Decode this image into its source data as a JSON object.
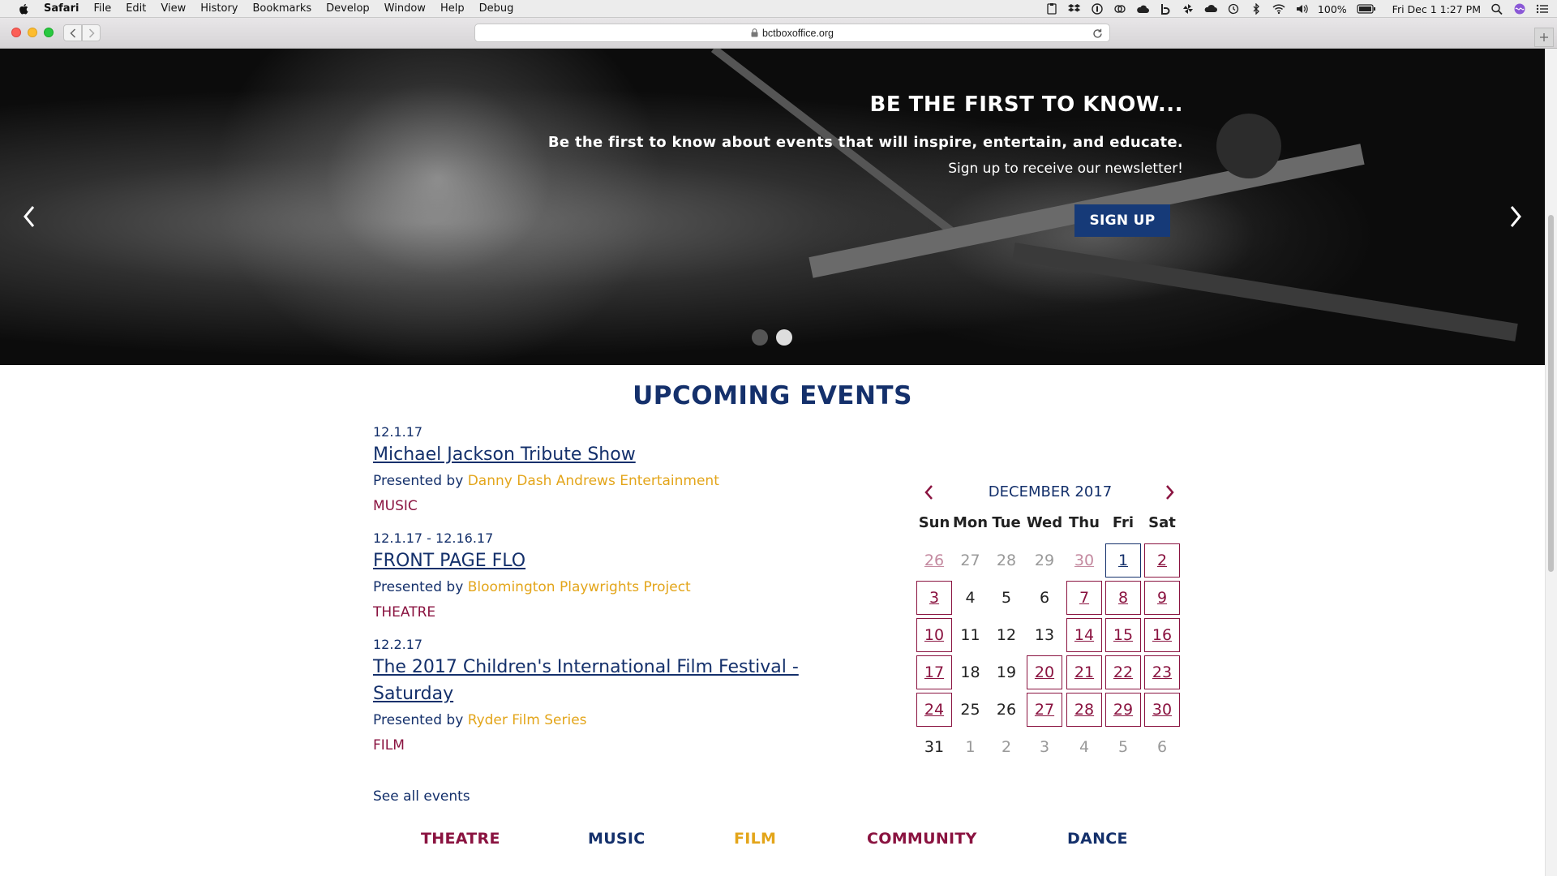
{
  "menubar": {
    "app": "Safari",
    "items": [
      "File",
      "Edit",
      "View",
      "History",
      "Bookmarks",
      "Develop",
      "Window",
      "Help",
      "Debug"
    ],
    "battery": "100%",
    "clock": "Fri Dec 1  1:27 PM"
  },
  "browser": {
    "url": "bctboxoffice.org"
  },
  "hero": {
    "title": "BE THE FIRST TO KNOW...",
    "line1": "Be the first to know about events that will inspire, entertain, and educate.",
    "line2": "Sign up to receive our newsletter!",
    "button": "SIGN UP",
    "slide_count": 2,
    "active_slide": 2
  },
  "events_section": {
    "heading": "UPCOMING EVENTS",
    "presented_by": "Presented by",
    "events": [
      {
        "date": "12.1.17",
        "title": "Michael Jackson Tribute Show",
        "presenter": "Danny Dash Andrews Entertainment",
        "category": "MUSIC"
      },
      {
        "date": "12.1.17 - 12.16.17",
        "title": "FRONT PAGE FLO",
        "presenter": "Bloomington Playwrights Project",
        "category": "THEATRE"
      },
      {
        "date": "12.2.17",
        "title": "The 2017 Children's International Film Festival - Saturday",
        "presenter": "Ryder Film Series",
        "category": "FILM"
      }
    ],
    "see_all": "See all events"
  },
  "calendar": {
    "month": "DECEMBER 2017",
    "weekdays": [
      "Sun",
      "Mon",
      "Tue",
      "Wed",
      "Thu",
      "Fri",
      "Sat"
    ],
    "days": [
      {
        "d": "26",
        "t": "other-ev"
      },
      {
        "d": "27",
        "t": "other"
      },
      {
        "d": "28",
        "t": "other"
      },
      {
        "d": "29",
        "t": "other"
      },
      {
        "d": "30",
        "t": "other-ev"
      },
      {
        "d": "1",
        "t": "today"
      },
      {
        "d": "2",
        "t": "ev"
      },
      {
        "d": "3",
        "t": "ev"
      },
      {
        "d": "4",
        "t": "plain"
      },
      {
        "d": "5",
        "t": "plain"
      },
      {
        "d": "6",
        "t": "plain"
      },
      {
        "d": "7",
        "t": "ev"
      },
      {
        "d": "8",
        "t": "ev"
      },
      {
        "d": "9",
        "t": "ev"
      },
      {
        "d": "10",
        "t": "ev"
      },
      {
        "d": "11",
        "t": "plain"
      },
      {
        "d": "12",
        "t": "plain"
      },
      {
        "d": "13",
        "t": "plain"
      },
      {
        "d": "14",
        "t": "ev"
      },
      {
        "d": "15",
        "t": "ev"
      },
      {
        "d": "16",
        "t": "ev"
      },
      {
        "d": "17",
        "t": "ev"
      },
      {
        "d": "18",
        "t": "plain"
      },
      {
        "d": "19",
        "t": "plain"
      },
      {
        "d": "20",
        "t": "ev"
      },
      {
        "d": "21",
        "t": "ev"
      },
      {
        "d": "22",
        "t": "ev"
      },
      {
        "d": "23",
        "t": "ev"
      },
      {
        "d": "24",
        "t": "ev"
      },
      {
        "d": "25",
        "t": "plain"
      },
      {
        "d": "26",
        "t": "plain"
      },
      {
        "d": "27",
        "t": "ev"
      },
      {
        "d": "28",
        "t": "ev"
      },
      {
        "d": "29",
        "t": "ev"
      },
      {
        "d": "30",
        "t": "ev"
      },
      {
        "d": "31",
        "t": "plain"
      },
      {
        "d": "1",
        "t": "other"
      },
      {
        "d": "2",
        "t": "other"
      },
      {
        "d": "3",
        "t": "other"
      },
      {
        "d": "4",
        "t": "other"
      },
      {
        "d": "5",
        "t": "other"
      },
      {
        "d": "6",
        "t": "other"
      }
    ]
  },
  "categories": [
    {
      "label": "THEATRE",
      "color": "#8a1340"
    },
    {
      "label": "MUSIC",
      "color": "#14306b"
    },
    {
      "label": "FILM",
      "color": "#e3a51a"
    },
    {
      "label": "COMMUNITY",
      "color": "#8a1340"
    },
    {
      "label": "DANCE",
      "color": "#14306b"
    }
  ],
  "colors": {
    "navy": "#14306b",
    "maroon": "#8a1340",
    "gold": "#e3a51a",
    "button_blue": "#163a78"
  }
}
